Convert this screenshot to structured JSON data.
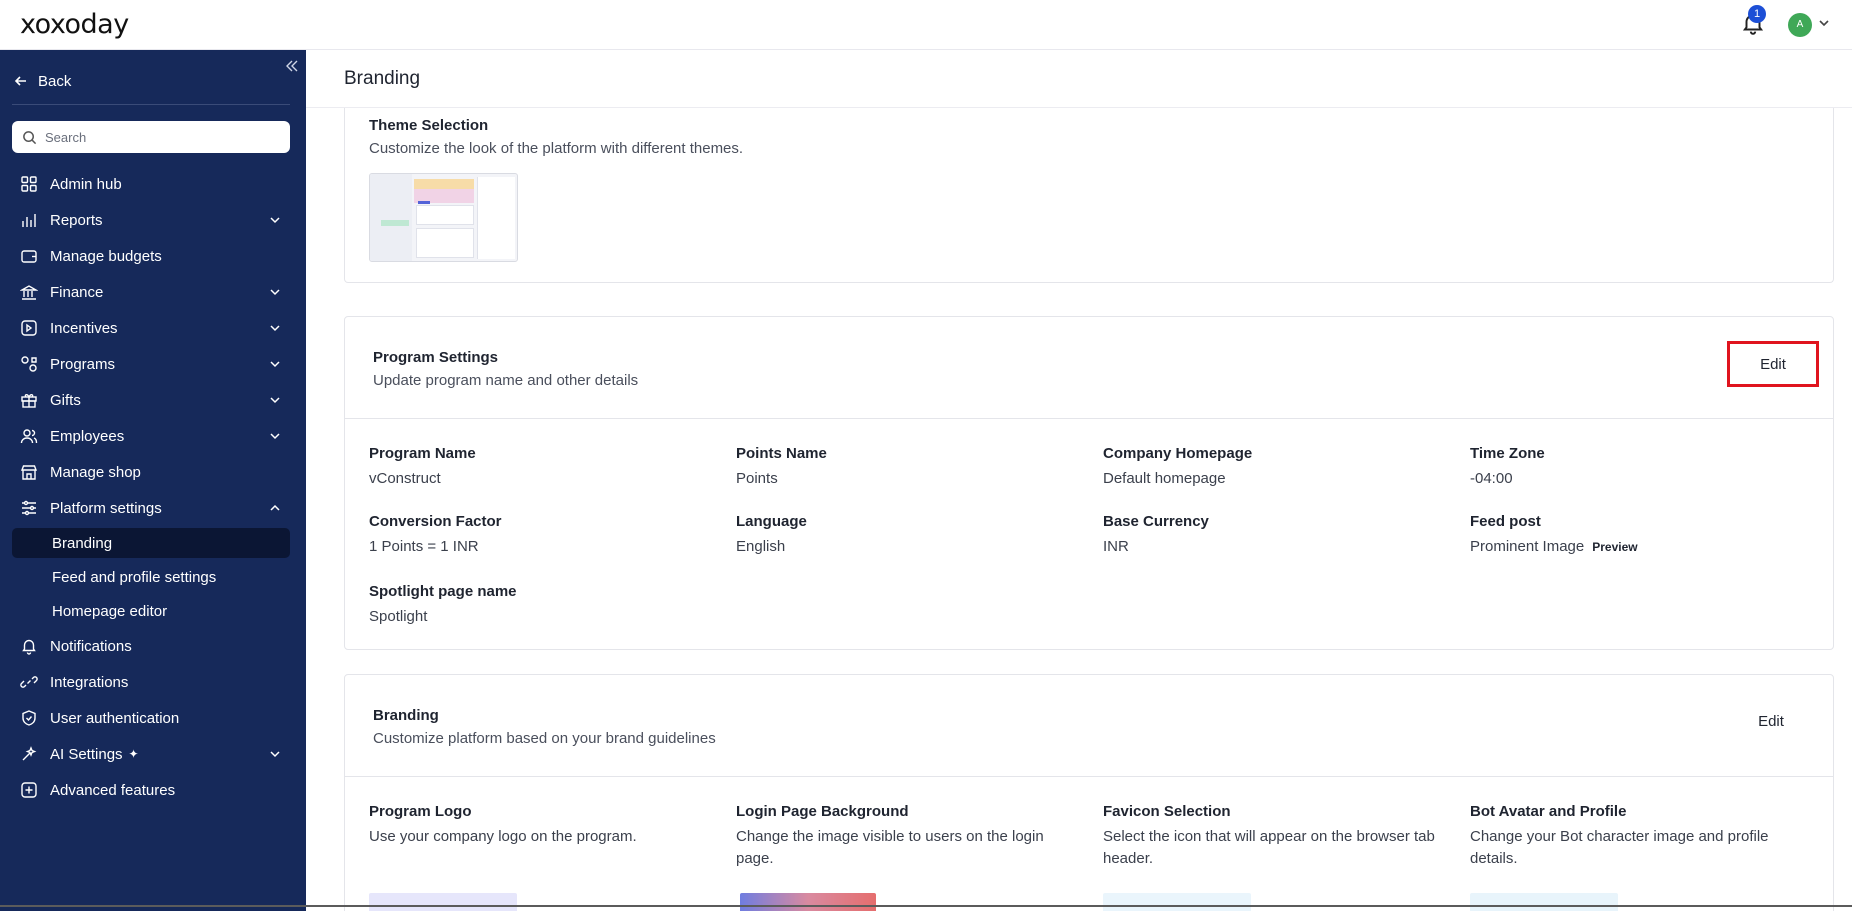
{
  "app": {
    "logo": "xoxoday"
  },
  "topbar": {
    "notification_count": "1",
    "avatar_initial": "A"
  },
  "sidebar": {
    "back_label": "Back",
    "search_placeholder": "Search",
    "items": [
      {
        "label": "Admin hub",
        "icon": "grid-icon",
        "has_chevron": false
      },
      {
        "label": "Reports",
        "icon": "bar-chart-icon",
        "has_chevron": true
      },
      {
        "label": "Manage budgets",
        "icon": "wallet-icon",
        "has_chevron": false
      },
      {
        "label": "Finance",
        "icon": "bank-icon",
        "has_chevron": true
      },
      {
        "label": "Incentives",
        "icon": "incentive-icon",
        "has_chevron": true
      },
      {
        "label": "Programs",
        "icon": "programs-icon",
        "has_chevron": true
      },
      {
        "label": "Gifts",
        "icon": "gift-icon",
        "has_chevron": true
      },
      {
        "label": "Employees",
        "icon": "users-icon",
        "has_chevron": true
      },
      {
        "label": "Manage shop",
        "icon": "shop-icon",
        "has_chevron": false
      },
      {
        "label": "Platform settings",
        "icon": "sliders-icon",
        "has_chevron": true,
        "expanded": true
      }
    ],
    "platform_sub_items": [
      {
        "label": "Branding",
        "active": true
      },
      {
        "label": "Feed and profile settings",
        "active": false
      },
      {
        "label": "Homepage editor",
        "active": false
      }
    ],
    "items_after": [
      {
        "label": "Notifications",
        "icon": "bell-icon",
        "has_chevron": false
      },
      {
        "label": "Integrations",
        "icon": "link-icon",
        "has_chevron": false
      },
      {
        "label": "User authentication",
        "icon": "shield-icon",
        "has_chevron": false
      },
      {
        "label": "AI Settings",
        "icon": "ai-icon",
        "has_chevron": true,
        "sparkle": "✦"
      },
      {
        "label": "Advanced features",
        "icon": "plus-square-icon",
        "has_chevron": false
      }
    ]
  },
  "main": {
    "title": "Branding",
    "theme": {
      "title": "Theme Selection",
      "description": "Customize the look of the platform with different themes."
    },
    "program_settings": {
      "title": "Program Settings",
      "description": "Update program name and other details",
      "edit_label": "Edit",
      "fields": {
        "program_name": {
          "label": "Program Name",
          "value": "vConstruct"
        },
        "points_name": {
          "label": "Points Name",
          "value": "Points"
        },
        "company_homepage": {
          "label": "Company Homepage",
          "value": "Default homepage"
        },
        "time_zone": {
          "label": "Time Zone",
          "value": "-04:00"
        },
        "conversion_factor": {
          "label": "Conversion Factor",
          "value": "1 Points = 1 INR"
        },
        "language": {
          "label": "Language",
          "value": "English"
        },
        "base_currency": {
          "label": "Base Currency",
          "value": "INR"
        },
        "feed_post": {
          "label": "Feed post",
          "value": "Prominent Image",
          "preview_label": "Preview"
        },
        "spotlight": {
          "label": "Spotlight page name",
          "value": "Spotlight"
        }
      }
    },
    "branding": {
      "title": "Branding",
      "description": "Customize platform based on your brand guidelines",
      "edit_label": "Edit",
      "assets": {
        "program_logo": {
          "label": "Program Logo",
          "description": "Use your company logo on the program."
        },
        "login_bg": {
          "label": "Login Page Background",
          "description": "Change the image visible to users on the login page."
        },
        "favicon": {
          "label": "Favicon Selection",
          "description": "Select the icon that will appear on the browser tab header."
        },
        "bot_avatar": {
          "label": "Bot Avatar and Profile",
          "description": "Change your Bot character image and profile details."
        }
      }
    }
  },
  "colors": {
    "sidebar_bg": "#16295a",
    "active_item_bg": "#0b1634",
    "highlight": "#e0141e",
    "badge": "#1d4fd6",
    "avatar": "#3fa857"
  }
}
